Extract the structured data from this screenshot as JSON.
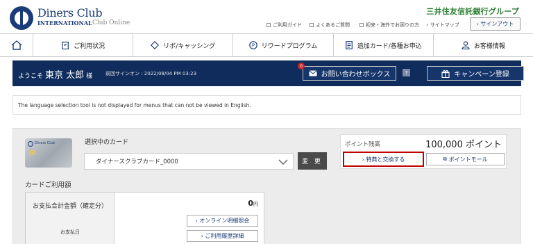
{
  "header": {
    "brand": "Diners Club",
    "brand_sub": "INTERNATIONAL",
    "brand_online": "Club Online",
    "bank": "三井住友信託銀行グループ",
    "util_links": [
      "ご利用ガイド",
      "よくあるご質問",
      "初来・海外でお困りの方",
      "サイトマップ"
    ],
    "signout": "サインアウト"
  },
  "nav": {
    "items": [
      "ご利用状況",
      "リボ/キャッシング",
      "リワードプログラム",
      "追加カード/各種お申込",
      "お客様情報"
    ]
  },
  "welcome": {
    "greeting": "ようこそ",
    "name": "東京 太郎",
    "honorific": "様",
    "last_signin": "前回サインオン : 2022/08/04 PM 03:23",
    "inbox_badge": "0",
    "inbox": "お問い合わせボックス",
    "help": "?",
    "campaign": "キャンペーン登録"
  },
  "notice": "The language selection tool is not displayed for menus that can not be viewed in English.",
  "card": {
    "selected_label": "選択中のカード",
    "selected_value": "ダイナースクラブカード_0000",
    "change": "変 更",
    "card_print": "Diners Club"
  },
  "points": {
    "label": "ポイント残高",
    "value": "100,000 ポイント",
    "exchange": "特典と交換する",
    "mall": "ポイントモール"
  },
  "usage": {
    "title": "カードご利用額",
    "total_label": "お支払合計金額（確定分）",
    "due_label": "お支払日",
    "amount": "0",
    "yen": "円",
    "online_detail": "オンライン明細照会",
    "history": "ご利用履歴詳細"
  }
}
